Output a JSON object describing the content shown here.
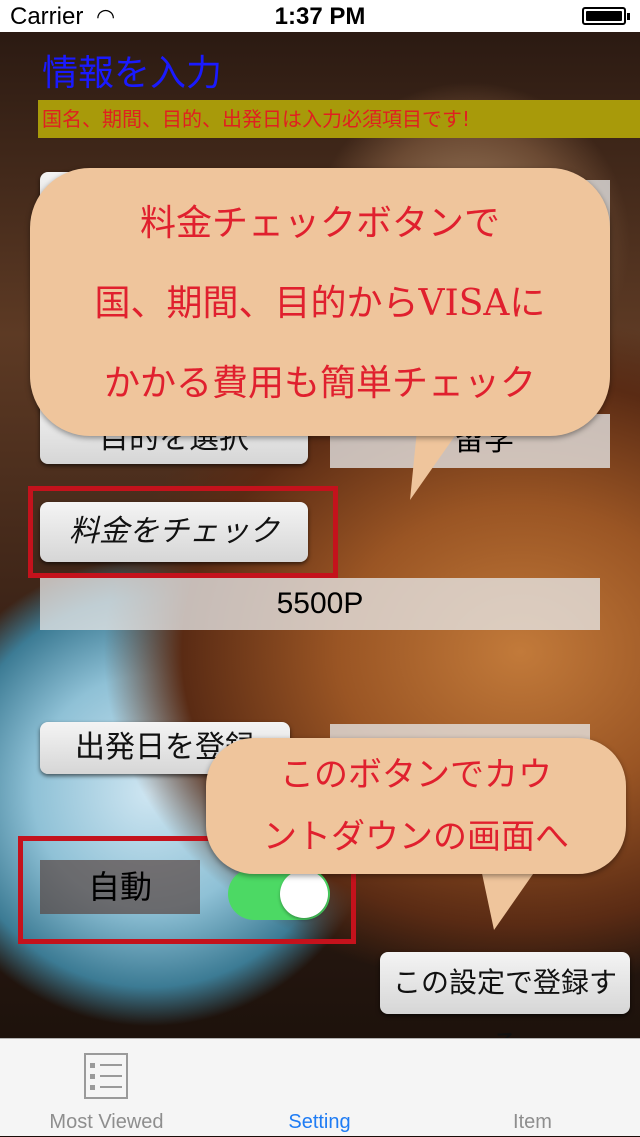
{
  "status_bar": {
    "carrier": "Carrier",
    "time": "1:37 PM"
  },
  "screen": {
    "title": "情報を入力",
    "notice": "国名、期間、目的、出発日は入力必須項目です!"
  },
  "form": {
    "purpose_button": "目的を選択",
    "purpose_value": "留学",
    "check_fee_button": "料金をチェック",
    "fee_value": "5500P",
    "departure_button": "出発日を登録",
    "departure_value": "",
    "auto_label": "自動",
    "auto_toggle_on": true,
    "register_button": "この設定で登録する"
  },
  "callouts": {
    "fee": [
      "料金チェックボタンで",
      "国、期間、目的からVISAに",
      "かかる費用も簡単チェック"
    ],
    "countdown": [
      "このボタンでカウ",
      "ントダウンの画面へ"
    ]
  },
  "tabs": [
    {
      "label": "Most Viewed",
      "icon": "list-icon",
      "active": false
    },
    {
      "label": "Setting",
      "icon": "",
      "active": true
    },
    {
      "label": "Item",
      "icon": "",
      "active": false
    }
  ],
  "colors": {
    "accent": "#1f7cf4",
    "highlight": "#c4121c",
    "toggle_on": "#4cd964"
  }
}
